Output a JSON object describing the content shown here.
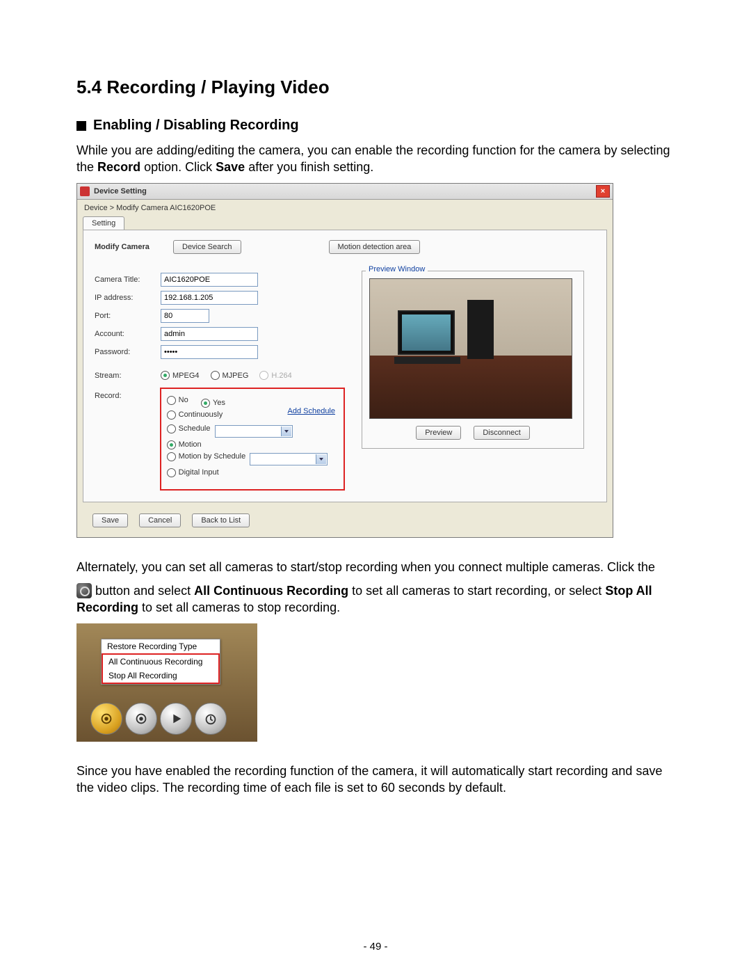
{
  "doc": {
    "section_heading": "5.4  Recording / Playing Video",
    "sub_heading": "Enabling / Disabling Recording",
    "p1": {
      "a": "While you are adding/editing the camera, you can enable the recording function for the camera by selecting the",
      "b1": "Record",
      "c": "option. Click",
      "b2": "Save",
      "d": "after you finish setting."
    },
    "p2": "Alternately, you can set all cameras to start/stop recording when you connect multiple cameras. Click the",
    "p3": {
      "a": " button and select",
      "b1": "All Continuous Recording",
      "c": "to set all cameras to start recording, or select",
      "b2": "Stop All Recording",
      "d": "to set all cameras to stop recording."
    },
    "p4": "Since you have enabled the recording function of the camera, it will automatically start recording and save the video clips. The recording time of each file is set to 60 seconds by default.",
    "page_number": "- 49 -"
  },
  "dlg": {
    "title": "Device Setting",
    "breadcrumb": "Device > Modify Camera AIC1620POE",
    "tab": "Setting",
    "modify_label": "Modify Camera",
    "device_search": "Device Search",
    "motion_area": "Motion detection area",
    "fields": {
      "camera_title": {
        "label": "Camera Title:",
        "value": "AIC1620POE"
      },
      "ip": {
        "label": "IP address:",
        "value": "192.168.1.205"
      },
      "port": {
        "label": "Port:",
        "value": "80"
      },
      "account": {
        "label": "Account:",
        "value": "admin"
      },
      "password": {
        "label": "Password:",
        "value": "*****"
      },
      "stream": {
        "label": "Stream:"
      },
      "record": {
        "label": "Record:"
      }
    },
    "stream": {
      "mpeg4": "MPEG4",
      "mjpeg": "MJPEG",
      "h264": "H.264"
    },
    "record": {
      "no": "No",
      "yes": "Yes",
      "add_schedule": "Add Schedule",
      "continuously": "Continuously",
      "schedule": "Schedule",
      "motion": "Motion",
      "motion_schedule": "Motion by Schedule",
      "digital_input": "Digital Input"
    },
    "preview": {
      "title": "Preview Window",
      "preview_btn": "Preview",
      "disconnect_btn": "Disconnect"
    },
    "buttons": {
      "save": "Save",
      "cancel": "Cancel",
      "back": "Back to List"
    }
  },
  "menu": {
    "items": [
      "Restore Recording Type",
      "All Continuous Recording",
      "Stop All Recording"
    ]
  }
}
